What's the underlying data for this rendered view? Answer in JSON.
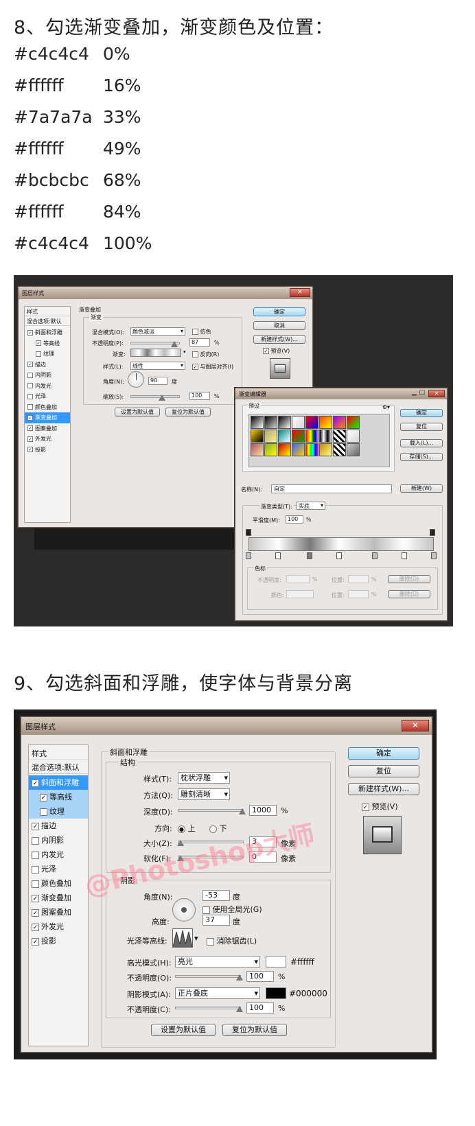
{
  "step8": {
    "heading": "8、勾选渐变叠加，渐变颜色及位置：",
    "colors": [
      {
        "hex": "#c4c4c4",
        "pos": "0%"
      },
      {
        "hex": "#ffffff",
        "pos": "16%"
      },
      {
        "hex": "#7a7a7a",
        "pos": "33%"
      },
      {
        "hex": "#ffffff",
        "pos": "49%"
      },
      {
        "hex": "#bcbcbc",
        "pos": "68%"
      },
      {
        "hex": "#ffffff",
        "pos": "84%"
      },
      {
        "hex": "#c4c4c4",
        "pos": "100%"
      }
    ]
  },
  "dialog1": {
    "title": "图层样式",
    "sidebar": {
      "header": "样式",
      "blend": "混合选项:默认",
      "items": [
        {
          "label": "斜面和浮雕",
          "checked": true
        },
        {
          "label": "等高线",
          "checked": true
        },
        {
          "label": "纹理",
          "checked": false
        },
        {
          "label": "描边",
          "checked": true
        },
        {
          "label": "内阴影",
          "checked": false
        },
        {
          "label": "内发光",
          "checked": false
        },
        {
          "label": "光泽",
          "checked": false
        },
        {
          "label": "颜色叠加",
          "checked": false
        },
        {
          "label": "渐变叠加",
          "checked": true
        },
        {
          "label": "图案叠加",
          "checked": true
        },
        {
          "label": "外发光",
          "checked": true
        },
        {
          "label": "投影",
          "checked": true
        }
      ]
    },
    "section": "渐变叠加",
    "group": "渐变",
    "blend_label": "混合模式(O):",
    "blend_value": "颜色减淡",
    "dither": "仿色",
    "opacity_label": "不透明度(P):",
    "opacity_value": "87",
    "gradient_label": "渐变:",
    "reverse": "反向(R)",
    "style_label": "样式(L):",
    "style_value": "线性",
    "align": "与图层对齐(I)",
    "angle_label": "角度(N):",
    "angle_value": "90",
    "angle_unit": "度",
    "scale_label": "缩放(S):",
    "scale_value": "100",
    "pct": "%",
    "btn_default": "设置为默认值",
    "btn_reset": "复位为默认值",
    "ok": "确定",
    "cancel": "取消",
    "new_style": "新建样式(W)...",
    "preview": "预览(V)"
  },
  "gradient_editor": {
    "title": "渐变编辑器",
    "presets": "预设",
    "ok": "确定",
    "reset": "复位",
    "load": "载入(L)...",
    "save": "存储(S)...",
    "name_label": "名称(N):",
    "name_value": "自定",
    "new": "新建(W)",
    "type_label": "渐变类型(T):",
    "type_value": "实底",
    "smooth_label": "平滑度(M):",
    "smooth_value": "100",
    "pct": "%",
    "stops": "色标",
    "opacity": "不透明度:",
    "color": "颜色:",
    "location": "位置:",
    "delete": "删除(D)"
  },
  "step9": {
    "heading": "9、勾选斜面和浮雕，使字体与背景分离"
  },
  "dialog2": {
    "title": "图层样式",
    "sidebar": {
      "header": "样式",
      "blend": "混合选项:默认",
      "items": [
        {
          "label": "斜面和浮雕",
          "checked": true
        },
        {
          "label": "等高线",
          "checked": true
        },
        {
          "label": "纹理",
          "checked": false
        },
        {
          "label": "描边",
          "checked": true
        },
        {
          "label": "内阴影",
          "checked": false
        },
        {
          "label": "内发光",
          "checked": false
        },
        {
          "label": "光泽",
          "checked": false
        },
        {
          "label": "颜色叠加",
          "checked": false
        },
        {
          "label": "渐变叠加",
          "checked": true
        },
        {
          "label": "图案叠加",
          "checked": true
        },
        {
          "label": "外发光",
          "checked": true
        },
        {
          "label": "投影",
          "checked": true
        }
      ]
    },
    "section": "斜面和浮雕",
    "structure": "结构",
    "style_label": "样式(T):",
    "style_value": "枕状浮雕",
    "technique_label": "方法(Q):",
    "technique_value": "雕刻清晰",
    "depth_label": "深度(D):",
    "depth_value": "1000",
    "direction_label": "方向:",
    "up": "上",
    "down": "下",
    "size_label": "大小(Z):",
    "size_value": "3",
    "soften_label": "软化(F):",
    "soften_value": "0",
    "px": "像素",
    "pct": "%",
    "shading": "阴影",
    "angle_label": "角度(N):",
    "angle_value": "-53",
    "deg": "度",
    "global_light": "使用全局光(G)",
    "altitude_label": "高度:",
    "altitude_value": "37",
    "gloss_label": "光泽等高线:",
    "antialias": "消除锯齿(L)",
    "highlight_label": "高光模式(H):",
    "highlight_value": "亮光",
    "highlight_color": "#ffffff",
    "hl_opacity_label": "不透明度(O):",
    "hl_opacity_value": "100",
    "shadow_label": "阴影模式(A):",
    "shadow_value": "正片叠底",
    "shadow_color": "#000000",
    "sh_opacity_label": "不透明度(C):",
    "sh_opacity_value": "100",
    "btn_default": "设置为默认值",
    "btn_reset": "复位为默认值",
    "ok": "确定",
    "reset": "复位",
    "new_style": "新建样式(W)...",
    "preview": "预览(V)",
    "watermark": "@Photoshop大师"
  }
}
